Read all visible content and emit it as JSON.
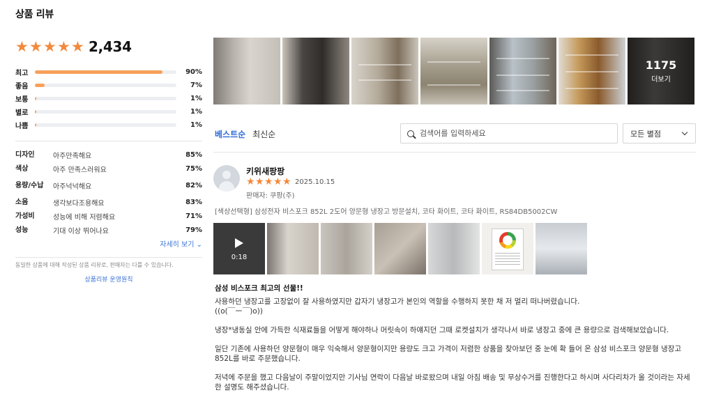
{
  "page": {
    "title": "상품 리뷰"
  },
  "summary": {
    "total_count": "2,434",
    "stars_filled": 5,
    "star_color": "#f3893d",
    "distribution": [
      {
        "label": "최고",
        "pct": "90%",
        "value": 90
      },
      {
        "label": "좋음",
        "pct": "7%",
        "value": 7
      },
      {
        "label": "보통",
        "pct": "1%",
        "value": 1
      },
      {
        "label": "별로",
        "pct": "1%",
        "value": 1
      },
      {
        "label": "나쁨",
        "pct": "1%",
        "value": 1
      }
    ],
    "bar_color": "#f6a05b"
  },
  "attributes": [
    {
      "name": "디자인",
      "value": "아주만족해요",
      "pct": "85%"
    },
    {
      "name": "색상",
      "value": "아주 만족스러워요",
      "pct": "75%"
    },
    {
      "name": "용량/수납",
      "value": "아주넉넉해요",
      "pct": "82%"
    },
    {
      "name": "소음",
      "value": "생각보다조용해요",
      "pct": "83%"
    },
    {
      "name": "가성비",
      "value": "성능에 비해 저렴해요",
      "pct": "71%"
    },
    {
      "name": "성능",
      "value": "기대 이상 뛰어나요",
      "pct": "79%"
    }
  ],
  "more_link": "자세히 보기",
  "notice": "동일한 상품에 대해 작성된 상품 리뷰로, 판매자는 다를 수 있습니다.",
  "policy_link": "상품리뷰 운영원칙",
  "gallery": {
    "more_count": "1175",
    "more_label": "더보기"
  },
  "toolbar": {
    "sort_best": "베스트순",
    "sort_recent": "최신순",
    "search_placeholder": "검색어를 입력하세요",
    "filter_value": "모든 별점"
  },
  "review": {
    "author": "키위새팡팡",
    "stars_filled": 5,
    "date": "2025.10.15",
    "seller": "판매자: 쿠팡(주)",
    "option": "[색상선택형] 삼성전자 비스포크 852L 2도어 양문형 냉장고 방문설치, 코타 화이트, 코타 화이트, RS84DB5002CW",
    "video_duration": "0:18",
    "energy_label_grade": "2",
    "title": "삼성 비스포크 최고의 선물!!",
    "paragraphs": [
      "사용하던 냉장고를 고장없이 잘 사용하였지만 갑자기 냉장고가 본인의 역할을 수행하지 못한 채 저 멀리 떠나버렸습니다.",
      "((o(￣ー￣)o))",
      "냉장*냉동실 안에 가득한 식재료들을 어떻게 해야하나 머릿속이 하얘지던 그때 로켓설치가 생각나서 바로 냉장고 중에 큰 용량으로 검색해보았습니다.",
      "일단 기존에 사용하던 양문형이 매우 익숙해서 양문형이지만 용량도 크고 가격이 저렴한 상품을 찾아보던 중 눈에 확 들어 온 삼성 비스포크 양문형 냉장고 852L를 바로 주문했습니다.",
      "저녁에 주문을 했고 다음날이 주말이었지만 기사님 연락이 다음날 바로왔으며 내일 아침 배송 및 무상수거를 진행한다고 하시며 사다리차가 올 것이라는 자세한 설명도 해주셨습니다."
    ]
  },
  "accent_color": "#2e6bd8"
}
